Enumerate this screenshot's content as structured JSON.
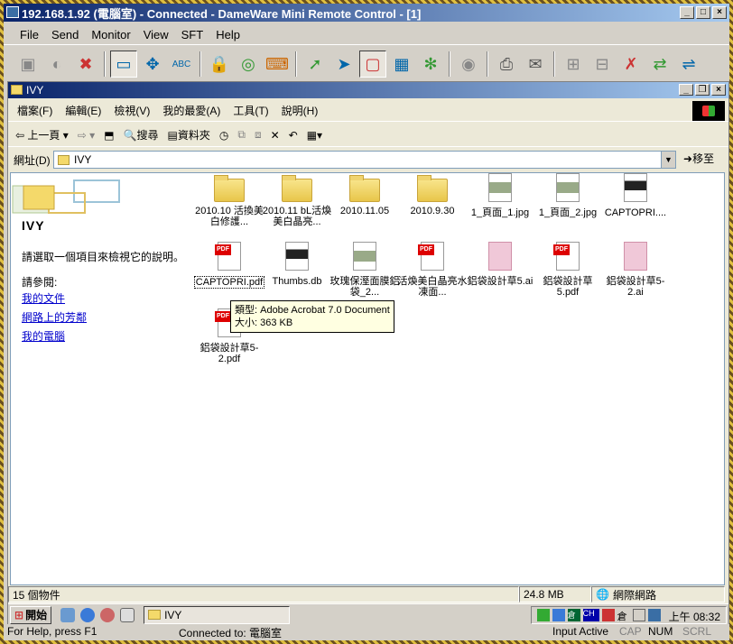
{
  "outer": {
    "title": "192.168.1.92 (電腦室) - Connected - DameWare Mini Remote Control - [1]",
    "menu": [
      "File",
      "Send",
      "Monitor",
      "View",
      "SFT",
      "Help"
    ],
    "status": {
      "help": "For Help, press F1",
      "connected": "Connected to: 電腦室",
      "input": "Input Active",
      "cap": "CAP",
      "num": "NUM",
      "scrl": "SCRL"
    }
  },
  "explorer": {
    "title": "IVY",
    "menu": [
      "檔案(F)",
      "編輯(E)",
      "檢視(V)",
      "我的最愛(A)",
      "工具(T)",
      "說明(H)"
    ],
    "toolbar": {
      "back": "上一頁",
      "search": "搜尋",
      "folders": "資料夾"
    },
    "address_label": "網址(D)",
    "address_value": "IVY",
    "go": "移至",
    "status": {
      "count": "15 個物件",
      "size": "24.8 MB",
      "zone": "網際網路"
    }
  },
  "details": {
    "folder_name": "IVY",
    "hint": "請選取一個項目來檢視它的說明。",
    "see_also": "請參閱:",
    "links": [
      "我的文件",
      "網路上的芳鄰",
      "我的電腦"
    ]
  },
  "files": [
    "2010.10 活換美白修護...",
    "2010.11 bL活煥美白晶亮...",
    "2010.11.05",
    "2010.9.30",
    "1_頁面_1.jpg",
    "1_頁面_2.jpg",
    "CAPTOPRI....",
    "CAPTOPRI.pdf",
    "Thumbs.db",
    "玫瑰保溼面膜鋁袋_2...",
    "活煥美白晶亮水凍面...",
    "鋁袋設計草5.ai",
    "鋁袋設計草5.pdf",
    "鋁袋設計草5-2.ai",
    "鋁袋設計草5-2.pdf"
  ],
  "tooltip": {
    "type_line": "類型: Adobe Acrobat 7.0 Document",
    "size_line": "大小: 363 KB"
  },
  "taskbar": {
    "start": "開始",
    "task": "IVY",
    "clock": "上午 08:32"
  }
}
